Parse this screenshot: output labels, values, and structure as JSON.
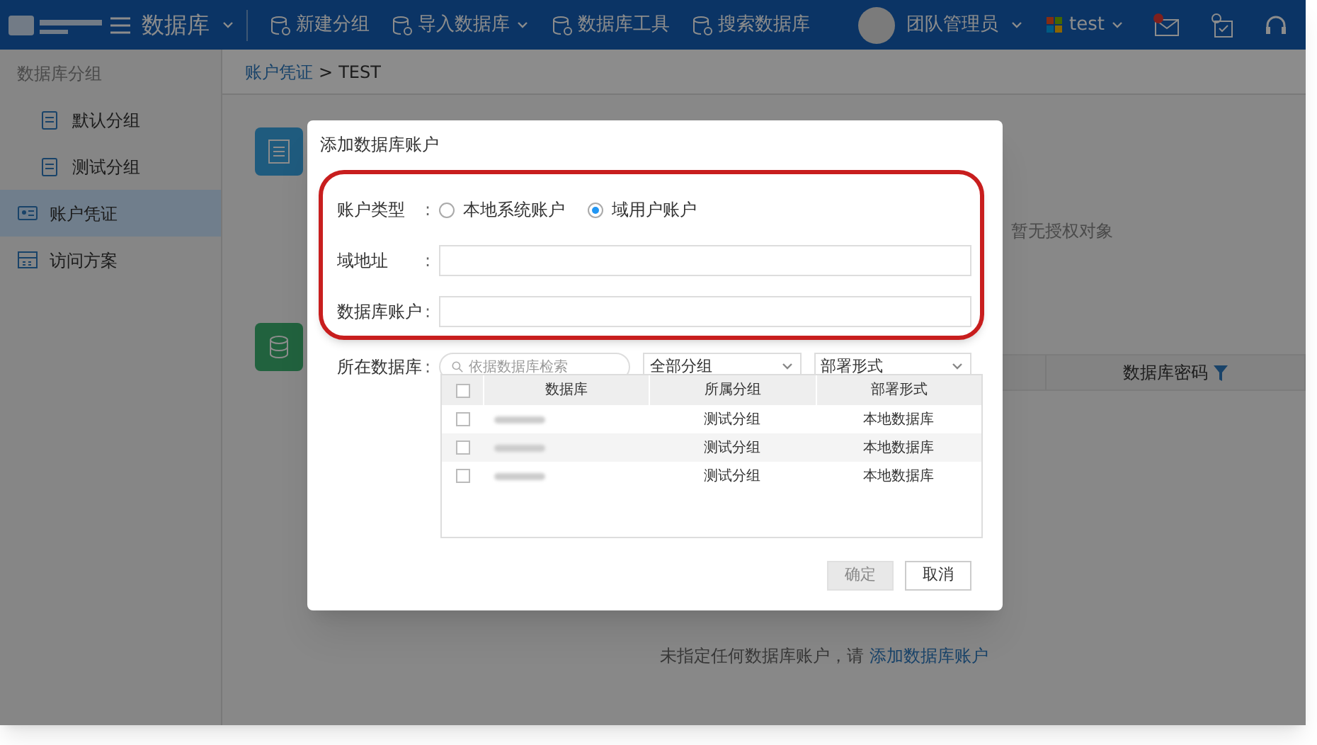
{
  "topbar": {
    "brand": "数据库",
    "tools": [
      {
        "label": "新建分组",
        "has_menu": false
      },
      {
        "label": "导入数据库",
        "has_menu": true
      },
      {
        "label": "数据库工具",
        "has_menu": false
      },
      {
        "label": "搜索数据库",
        "has_menu": false
      }
    ],
    "user": "团队管理员",
    "tenant": "test",
    "mail_unread": true
  },
  "sidebar": {
    "heading": "数据库分组",
    "items": [
      {
        "label": "默认分组",
        "kind": "group",
        "selected": false
      },
      {
        "label": "测试分组",
        "kind": "group",
        "selected": false
      },
      {
        "label": "账户凭证",
        "kind": "credential",
        "selected": true
      },
      {
        "label": "访问方案",
        "kind": "plan",
        "selected": false
      }
    ]
  },
  "breadcrumb": {
    "link": "账户凭证",
    "separator": ">",
    "current": "TEST"
  },
  "background": {
    "empty_auth": "暂无授权对象",
    "table_column": "数据库密码",
    "empty_hint": "未指定任何数据库账户，请",
    "empty_link": "添加数据库账户"
  },
  "dialog": {
    "title": "添加数据库账户",
    "account_type": {
      "label": "账户类型",
      "colon": ":",
      "options": [
        {
          "label": "本地系统账户",
          "selected": false
        },
        {
          "label": "域用户账户",
          "selected": true
        }
      ]
    },
    "fields": [
      {
        "label": "域地址",
        "colon": ":"
      },
      {
        "label": "数据库账户",
        "colon": ":"
      }
    ],
    "database": {
      "label": "所在数据库",
      "colon": ":",
      "placeholder": "依据数据库检索",
      "group_filter": "全部分组",
      "deploy_filter": "部署形式"
    },
    "table": {
      "columns": [
        "数据库",
        "所属分组",
        "部署形式"
      ],
      "header_checked": false,
      "rows": [
        {
          "checked": false,
          "group": "测试分组",
          "deploy": "本地数据库"
        },
        {
          "checked": false,
          "group": "测试分组",
          "deploy": "本地数据库"
        },
        {
          "checked": false,
          "group": "测试分组",
          "deploy": "本地数据库"
        }
      ]
    },
    "buttons": [
      {
        "label": "确定",
        "disabled": true
      },
      {
        "label": "取消",
        "disabled": false
      }
    ]
  }
}
